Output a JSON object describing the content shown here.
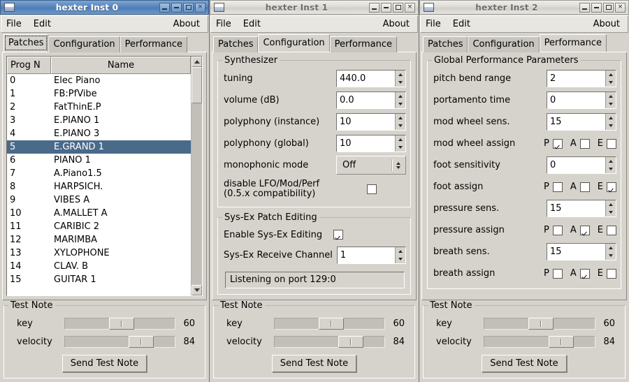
{
  "theme": {
    "bg": "#d6d3cc",
    "active_title_bg": "#5a85bb",
    "inactive_title_bg": "#dedbd5",
    "selection_bg": "#4a6a8a",
    "entry_bg": "#ffffff"
  },
  "windows": [
    {
      "title": "hexter Inst 0",
      "active": true,
      "icon": "window-icon",
      "buttons": {
        "minimize": "minimize-icon",
        "shade": "shade-icon",
        "maximize": "maximize-icon",
        "close": "×"
      },
      "menu": {
        "file": "File",
        "edit": "Edit",
        "about": "About"
      },
      "tabs": [
        {
          "label": "Patches",
          "active": true,
          "focused": true
        },
        {
          "label": "Configuration",
          "active": false,
          "focused": false
        },
        {
          "label": "Performance",
          "active": false,
          "focused": false
        }
      ],
      "patches": {
        "columns": [
          "Prog N",
          "Name"
        ],
        "selected_index": 5,
        "rows": [
          {
            "prog": "0",
            "name": "Elec Piano"
          },
          {
            "prog": "1",
            "name": "FB:PfVibe"
          },
          {
            "prog": "2",
            "name": "FatThinE.P"
          },
          {
            "prog": "3",
            "name": "E.PIANO 1"
          },
          {
            "prog": "4",
            "name": "E.PIANO 3"
          },
          {
            "prog": "5",
            "name": "E.GRAND 1"
          },
          {
            "prog": "6",
            "name": "PIANO   1"
          },
          {
            "prog": "7",
            "name": "A.Piano1.5"
          },
          {
            "prog": "8",
            "name": "HARPSICH."
          },
          {
            "prog": "9",
            "name": "VIBES   A"
          },
          {
            "prog": "10",
            "name": "A.MALLET A"
          },
          {
            "prog": "11",
            "name": "CARIBIC 2"
          },
          {
            "prog": "12",
            "name": "MARIMBA"
          },
          {
            "prog": "13",
            "name": "XYLOPHONE"
          },
          {
            "prog": "14",
            "name": "CLAV.   B"
          },
          {
            "prog": "15",
            "name": "GUITAR  1"
          }
        ]
      },
      "test_note": {
        "title": "Test Note",
        "key_label": "key",
        "key_value": "60",
        "key_pos_pct": 40,
        "velocity_label": "velocity",
        "velocity_value": "84",
        "velocity_pos_pct": 58,
        "send_label": "Send Test Note"
      }
    },
    {
      "title": "hexter Inst 1",
      "active": false,
      "icon": "window-icon",
      "buttons": {
        "minimize": "minimize-icon",
        "shade": "shade-icon",
        "maximize": "maximize-icon",
        "close": "×"
      },
      "menu": {
        "file": "File",
        "edit": "Edit",
        "about": "About"
      },
      "tabs": [
        {
          "label": "Patches",
          "active": false,
          "focused": false
        },
        {
          "label": "Configuration",
          "active": true,
          "focused": false
        },
        {
          "label": "Performance",
          "active": false,
          "focused": false
        }
      ],
      "synthesizer": {
        "title": "Synthesizer",
        "fields": [
          {
            "label": "tuning",
            "value": "440.0",
            "type": "spin"
          },
          {
            "label": "volume (dB)",
            "value": "0.0",
            "type": "spin"
          },
          {
            "label": "polyphony (instance)",
            "value": "10",
            "type": "spin"
          },
          {
            "label": "polyphony (global)",
            "value": "10",
            "type": "spin"
          }
        ],
        "monophonic": {
          "label": "monophonic mode",
          "value": "Off"
        },
        "disable_lfo": {
          "label_line1": "disable LFO/Mod/Perf",
          "label_line2": "(0.5.x compatibility)",
          "checked": false
        }
      },
      "sysex": {
        "title": "Sys-Ex Patch Editing",
        "enable": {
          "label": "Enable Sys-Ex Editing",
          "checked": true
        },
        "channel": {
          "label": "Sys-Ex Receive Channel",
          "value": "1"
        },
        "status": "Listening on port 129:0"
      },
      "test_note": {
        "title": "Test Note",
        "key_label": "key",
        "key_value": "60",
        "key_pos_pct": 40,
        "velocity_label": "velocity",
        "velocity_value": "84",
        "velocity_pos_pct": 58,
        "send_label": "Send Test Note"
      }
    },
    {
      "title": "hexter Inst 2",
      "active": false,
      "icon": "window-icon",
      "buttons": {
        "minimize": "minimize-icon",
        "shade": "shade-icon",
        "maximize": "maximize-icon",
        "close": "×"
      },
      "menu": {
        "file": "File",
        "edit": "Edit",
        "about": "About"
      },
      "tabs": [
        {
          "label": "Patches",
          "active": false,
          "focused": false
        },
        {
          "label": "Configuration",
          "active": false,
          "focused": false
        },
        {
          "label": "Performance",
          "active": true,
          "focused": false
        }
      ],
      "performance": {
        "title": "Global Performance Parameters",
        "rows": [
          {
            "type": "spin",
            "label": "pitch bend range",
            "value": "2"
          },
          {
            "type": "spin",
            "label": "portamento time",
            "value": "0"
          },
          {
            "type": "spin",
            "label": "mod wheel sens.",
            "value": "15"
          },
          {
            "type": "assign",
            "label": "mod wheel assign",
            "p": true,
            "a": false,
            "e": false
          },
          {
            "type": "spin",
            "label": "foot sensitivity",
            "value": "0"
          },
          {
            "type": "assign",
            "label": "foot assign",
            "p": false,
            "a": false,
            "e": true
          },
          {
            "type": "spin",
            "label": "pressure sens.",
            "value": "15"
          },
          {
            "type": "assign",
            "label": "pressure assign",
            "p": false,
            "a": true,
            "e": false
          },
          {
            "type": "spin",
            "label": "breath sens.",
            "value": "15"
          },
          {
            "type": "assign",
            "label": "breath assign",
            "p": false,
            "a": true,
            "e": false
          }
        ],
        "assign_letters": {
          "p": "P",
          "a": "A",
          "e": "E"
        }
      },
      "test_note": {
        "title": "Test Note",
        "key_label": "key",
        "key_value": "60",
        "key_pos_pct": 40,
        "velocity_label": "velocity",
        "velocity_value": "84",
        "velocity_pos_pct": 58,
        "send_label": "Send Test Note"
      }
    }
  ]
}
